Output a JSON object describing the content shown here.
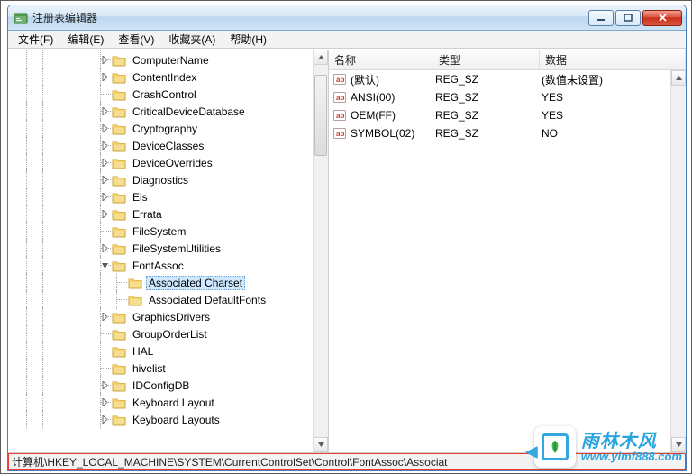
{
  "window": {
    "title": "注册表编辑器"
  },
  "menu": {
    "file": "文件(F)",
    "edit": "编辑(E)",
    "view": "查看(V)",
    "favorites": "收藏夹(A)",
    "help": "帮助(H)"
  },
  "tree": {
    "base_indent": 100,
    "indent_step": 18,
    "guide_positions": [
      18,
      36,
      54,
      100,
      118
    ],
    "nodes": [
      {
        "label": "ComputerName",
        "depth": 0,
        "expand": "closed"
      },
      {
        "label": "ContentIndex",
        "depth": 0,
        "expand": "closed"
      },
      {
        "label": "CrashControl",
        "depth": 0,
        "expand": "none"
      },
      {
        "label": "CriticalDeviceDatabase",
        "depth": 0,
        "expand": "closed"
      },
      {
        "label": "Cryptography",
        "depth": 0,
        "expand": "closed"
      },
      {
        "label": "DeviceClasses",
        "depth": 0,
        "expand": "closed"
      },
      {
        "label": "DeviceOverrides",
        "depth": 0,
        "expand": "closed"
      },
      {
        "label": "Diagnostics",
        "depth": 0,
        "expand": "closed"
      },
      {
        "label": "Els",
        "depth": 0,
        "expand": "closed"
      },
      {
        "label": "Errata",
        "depth": 0,
        "expand": "closed"
      },
      {
        "label": "FileSystem",
        "depth": 0,
        "expand": "none"
      },
      {
        "label": "FileSystemUtilities",
        "depth": 0,
        "expand": "closed"
      },
      {
        "label": "FontAssoc",
        "depth": 0,
        "expand": "open"
      },
      {
        "label": "Associated Charset",
        "depth": 1,
        "expand": "none",
        "selected": true
      },
      {
        "label": "Associated DefaultFonts",
        "depth": 1,
        "expand": "none"
      },
      {
        "label": "GraphicsDrivers",
        "depth": 0,
        "expand": "closed"
      },
      {
        "label": "GroupOrderList",
        "depth": 0,
        "expand": "none"
      },
      {
        "label": "HAL",
        "depth": 0,
        "expand": "none"
      },
      {
        "label": "hivelist",
        "depth": 0,
        "expand": "none"
      },
      {
        "label": "IDConfigDB",
        "depth": 0,
        "expand": "closed"
      },
      {
        "label": "Keyboard Layout",
        "depth": 0,
        "expand": "closed"
      },
      {
        "label": "Keyboard Layouts",
        "depth": 0,
        "expand": "closed"
      }
    ]
  },
  "list": {
    "columns": {
      "name": "名称",
      "type": "类型",
      "data": "数据"
    },
    "rows": [
      {
        "name": "(默认)",
        "type": "REG_SZ",
        "data": "(数值未设置)"
      },
      {
        "name": "ANSI(00)",
        "type": "REG_SZ",
        "data": "YES"
      },
      {
        "name": "OEM(FF)",
        "type": "REG_SZ",
        "data": "YES"
      },
      {
        "name": "SYMBOL(02)",
        "type": "REG_SZ",
        "data": "NO"
      }
    ]
  },
  "statusbar": {
    "path": "计算机\\HKEY_LOCAL_MACHINE\\SYSTEM\\CurrentControlSet\\Control\\FontAssoc\\Associat"
  },
  "watermark": {
    "cn": "雨林木风",
    "url": "www.ylmf888.com"
  },
  "icons": {
    "string_value_label": "ab"
  }
}
